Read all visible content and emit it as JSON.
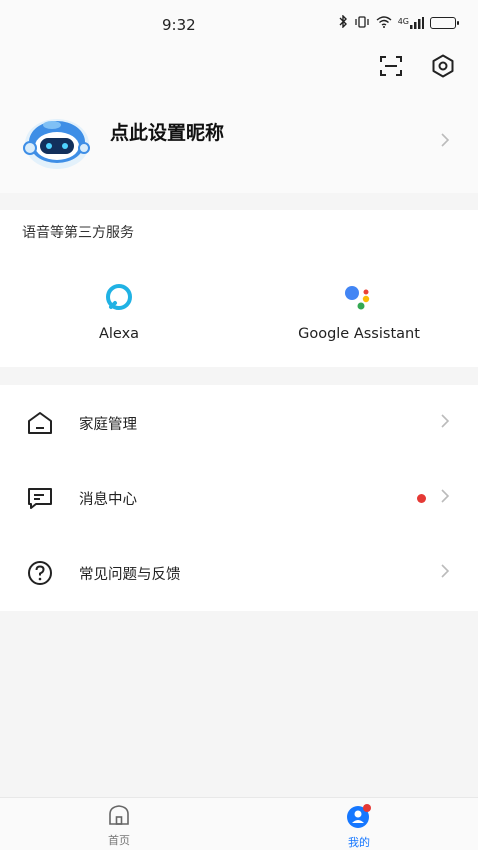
{
  "status_bar": {
    "time": "9:32",
    "signal_text": "4G"
  },
  "header": {
    "scan_icon": "scan-icon",
    "settings_icon": "settings-icon"
  },
  "profile": {
    "nickname_prompt": "点此设置昵称",
    "avatar_icon": "robot-avatar-icon"
  },
  "services": {
    "title": "语音等第三方服务",
    "items": [
      {
        "label": "Alexa",
        "icon": "alexa-icon",
        "color": "#20b2e4"
      },
      {
        "label": "Google Assistant",
        "icon": "google-assistant-icon"
      }
    ]
  },
  "menu": {
    "items": [
      {
        "label": "家庭管理",
        "icon": "home-outline-icon",
        "badge": false
      },
      {
        "label": "消息中心",
        "icon": "message-icon",
        "badge": true
      },
      {
        "label": "常见问题与反馈",
        "icon": "help-circle-icon",
        "badge": false
      }
    ]
  },
  "bottom_nav": {
    "items": [
      {
        "label": "首页",
        "icon": "home-tab-icon",
        "active": false
      },
      {
        "label": "我的",
        "icon": "profile-tab-icon",
        "active": true
      }
    ],
    "active_color": "#1677ff"
  }
}
